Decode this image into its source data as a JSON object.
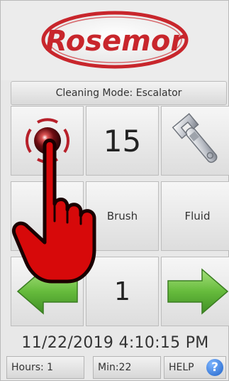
{
  "header": {
    "logo_text": "Rosemor"
  },
  "mode_bar": {
    "label": "Cleaning Mode: Escalator"
  },
  "controls": {
    "power_icon": "power-button-icon",
    "speed_value": "15",
    "settings_icon": "wrench-icon",
    "left_blank": "",
    "brush_label": "Brush",
    "fluid_label": "Fluid",
    "prev_icon": "left-arrow-icon",
    "counter_value": "1",
    "next_icon": "right-arrow-icon"
  },
  "datetime": "11/22/2019 4:10:15 PM",
  "status": {
    "hours": "Hours: 1",
    "min": "Min:22",
    "help": "HELP",
    "help_icon": "?"
  },
  "colors": {
    "logo_red": "#c8262c",
    "arrow_green": "#63b53a",
    "hand_red": "#d7090a"
  }
}
